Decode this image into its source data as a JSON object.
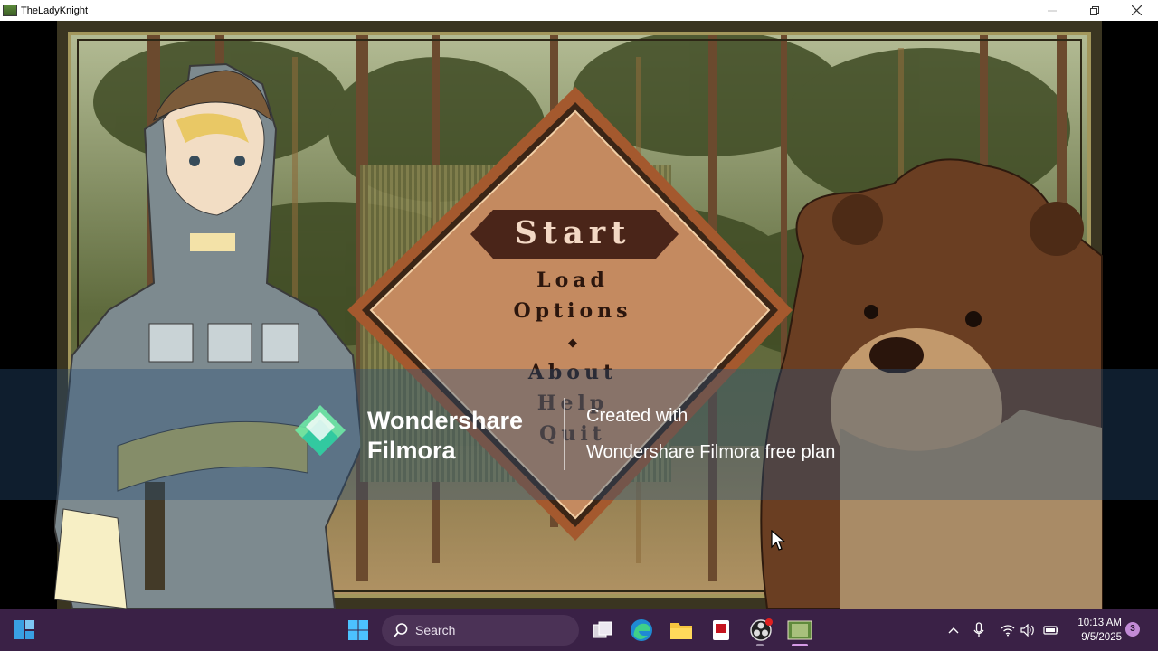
{
  "window": {
    "title": "TheLadyKnight",
    "controls": [
      "minimize-icon",
      "restore-icon",
      "close-icon"
    ]
  },
  "menu": {
    "start": "Start",
    "load": "Load",
    "options": "Options",
    "separator": "◆",
    "about": "About",
    "help": "Help",
    "quit": "Quit"
  },
  "watermark": {
    "brand": "Wondershare\nFilmora",
    "line1": "Created with",
    "line2": "Wondershare Filmora free plan"
  },
  "taskbar": {
    "search_label": "Search",
    "pinned": [
      "start-icon",
      "task-view-icon",
      "edge-icon",
      "file-explorer-icon",
      "red-app-icon",
      "obs-icon",
      "game-app-icon"
    ],
    "time": "10:13 AM",
    "date": "9/5/2025",
    "notification_count": "3",
    "tray": [
      "chevron-up-icon",
      "microphone-icon",
      "wifi-icon",
      "volume-icon",
      "battery-icon"
    ]
  },
  "colors": {
    "taskbar": "#3a2146",
    "menu_text": "#2c160d",
    "menu_diamond": "#c48a60",
    "start_banner": "#4a2519"
  }
}
